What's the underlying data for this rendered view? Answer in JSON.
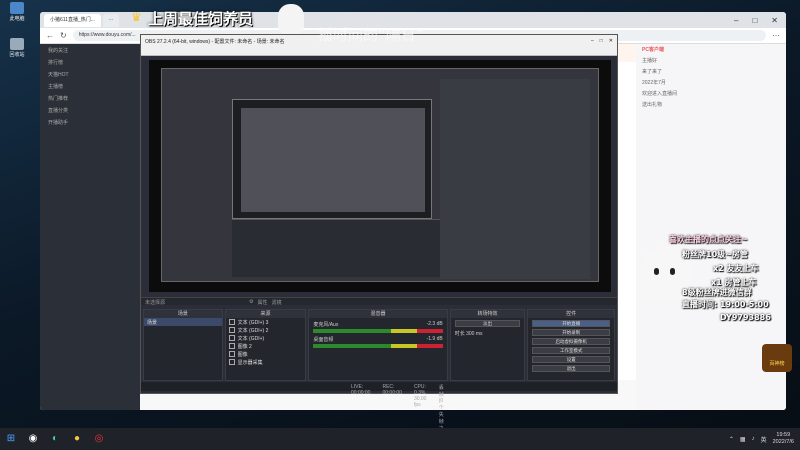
{
  "desktop": {
    "icons": [
      {
        "label": "此电脑"
      },
      {
        "label": "回收站"
      }
    ]
  },
  "browser": {
    "tab_title": "小猪611直播_热门...",
    "tab_title2": "...",
    "url": "https://www.douyu.com/...",
    "left_menu": [
      "我的关注",
      "排行榜",
      "天猫HOT",
      "主播榜",
      "热门推荐",
      "直播分类",
      "开播助手"
    ],
    "chat": [
      "主播好",
      "来了来了",
      "2022年7月",
      "欢迎进入直播间",
      "送出礼物",
      "PC客户端"
    ]
  },
  "obs": {
    "title": "OBS 27.2.4 (64-bit, windows) - 配置文件: 未命名 - 场景: 未命名",
    "docks": {
      "scenes": "场景",
      "sources": "来源",
      "mixer": "混音器",
      "transitions": "转场特效",
      "controls": "控件"
    },
    "scene_item": "场景",
    "sources": [
      "文本 (GDI+) 3",
      "文本 (GDI+) 2",
      "文本 (GDI+)",
      "图像 2",
      "图像",
      "显示器采集"
    ],
    "mixer": [
      {
        "name": "桌面音频",
        "db": "-1.9 dB"
      },
      {
        "name": "麦克风/Aux",
        "db": "-2.3 dB"
      }
    ],
    "transition": {
      "type": "淡出",
      "duration_label": "时长",
      "duration": "300 ms"
    },
    "controls": [
      "开始直播",
      "开始录制",
      "启动虚拟摄像机",
      "工作室模式",
      "设置",
      "退出"
    ],
    "preview_label": "未选择源",
    "props_btn": "属性",
    "filters_btn": "滤镜",
    "status": {
      "live": "LIVE: 00:00:00",
      "rec": "REC: 00:00:00",
      "cpu": "CPU: 0.3%, 30.00 fps",
      "drop": "丢帧 (0 个失帧之和)"
    }
  },
  "overlay": {
    "banner": "上周最佳饲养员",
    "ghost": "播时间的“隔日”",
    "lines": [
      "喜欢主播的点点关注~",
      "粉丝牌10级~房管",
      "x2 友友上车",
      "x1 房管上车",
      "8级粉丝牌进微信群",
      "直播时间: 19:00-5:00",
      "DY9793886"
    ],
    "badge": "百神榜"
  },
  "taskbar": {
    "time": "19:59",
    "date": "2022/7/6",
    "lang": "英"
  }
}
